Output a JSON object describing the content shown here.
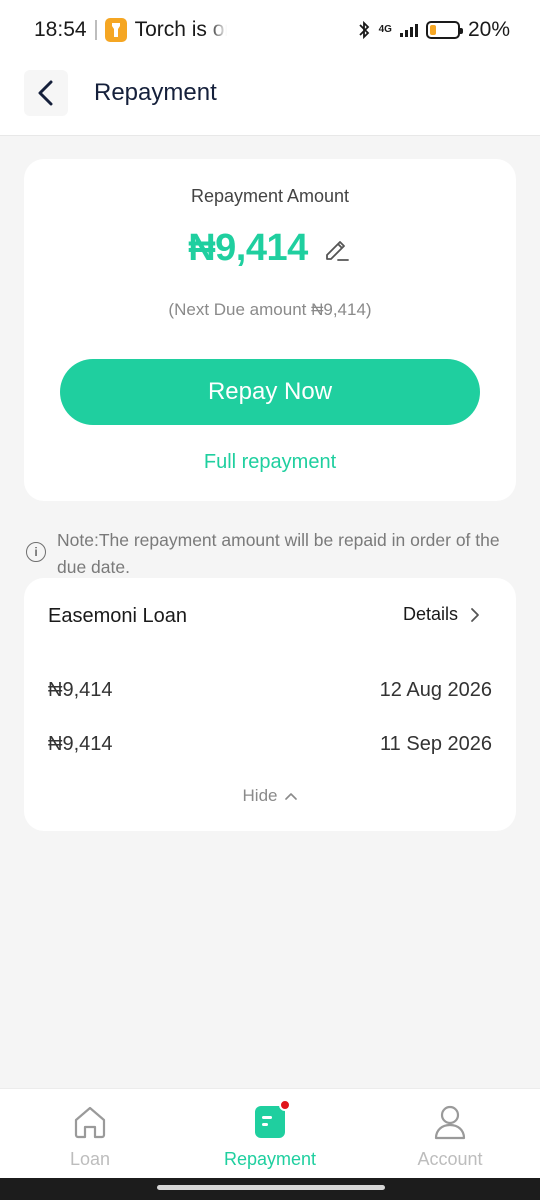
{
  "status_bar": {
    "time": "18:54",
    "notification": "Torch is on",
    "network": "4G",
    "battery": "20%"
  },
  "header": {
    "title": "Repayment"
  },
  "repayment_card": {
    "label": "Repayment Amount",
    "amount": "₦9,414",
    "next_due": "(Next Due amount ₦9,414)",
    "repay_button": "Repay Now",
    "full_repayment": "Full repayment"
  },
  "note": {
    "text": "Note:The repayment amount will be repaid in order of the due date."
  },
  "loan": {
    "name": "Easemoni Loan",
    "details_label": "Details",
    "installments": [
      {
        "amount": "₦9,414",
        "date": "12 Aug 2026"
      },
      {
        "amount": "₦9,414",
        "date": "11 Sep 2026"
      }
    ],
    "hide_label": "Hide"
  },
  "bottom_nav": {
    "items": [
      {
        "label": "Loan",
        "icon": "home-icon",
        "active": false
      },
      {
        "label": "Repayment",
        "icon": "repayment-icon",
        "active": true,
        "badge": true
      },
      {
        "label": "Account",
        "icon": "user-icon",
        "active": false
      }
    ]
  },
  "colors": {
    "accent": "#1fcf9f",
    "badge": "#e0151b",
    "battery": "#f5a623"
  }
}
